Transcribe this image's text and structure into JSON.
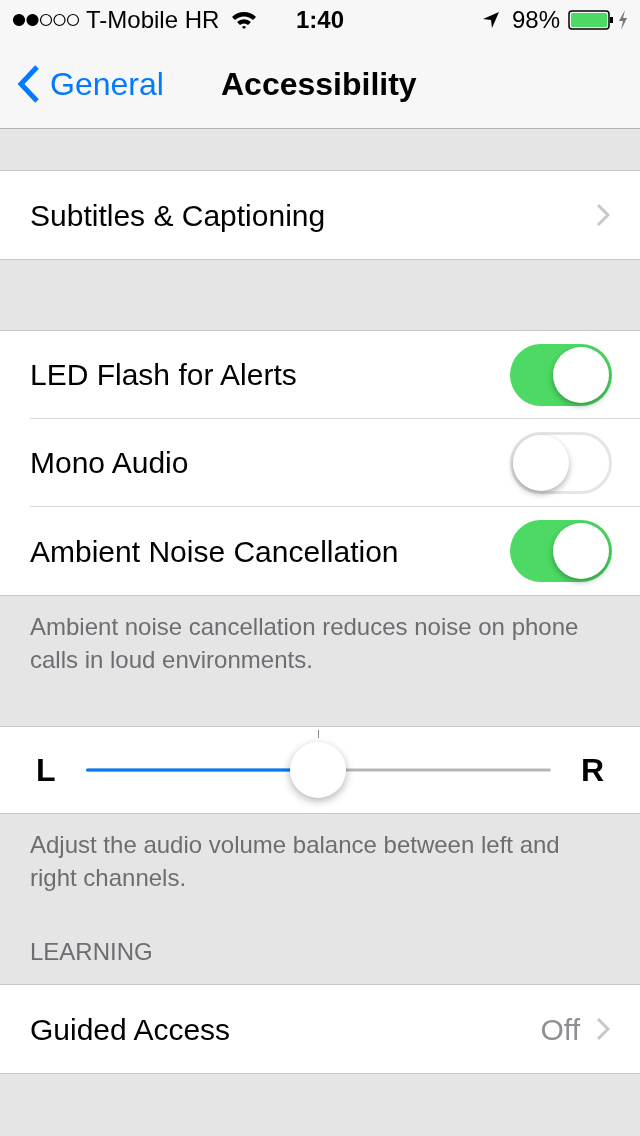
{
  "status_bar": {
    "carrier": "T-Mobile HR",
    "time": "1:40",
    "battery": "98%"
  },
  "nav": {
    "back": "General",
    "title": "Accessibility"
  },
  "group_1": [
    {
      "kind": "link",
      "label": "Subtitles & Captioning"
    }
  ],
  "group_2": [
    {
      "kind": "switch",
      "label": "LED Flash for Alerts",
      "on": true
    },
    {
      "kind": "switch",
      "label": "Mono Audio",
      "on": false
    },
    {
      "kind": "switch",
      "label": "Ambient Noise Cancellation",
      "on": true
    }
  ],
  "group_2_footer": "Ambient noise cancellation reduces noise on phone calls in loud environments.",
  "balance": {
    "left": "L",
    "right": "R",
    "level": 0.5
  },
  "balance_footer": "Adjust the audio volume balance between left and right channels.",
  "learning_header": "LEARNING",
  "group_3": [
    {
      "kind": "link",
      "label": "Guided Access",
      "value": "Off"
    }
  ]
}
